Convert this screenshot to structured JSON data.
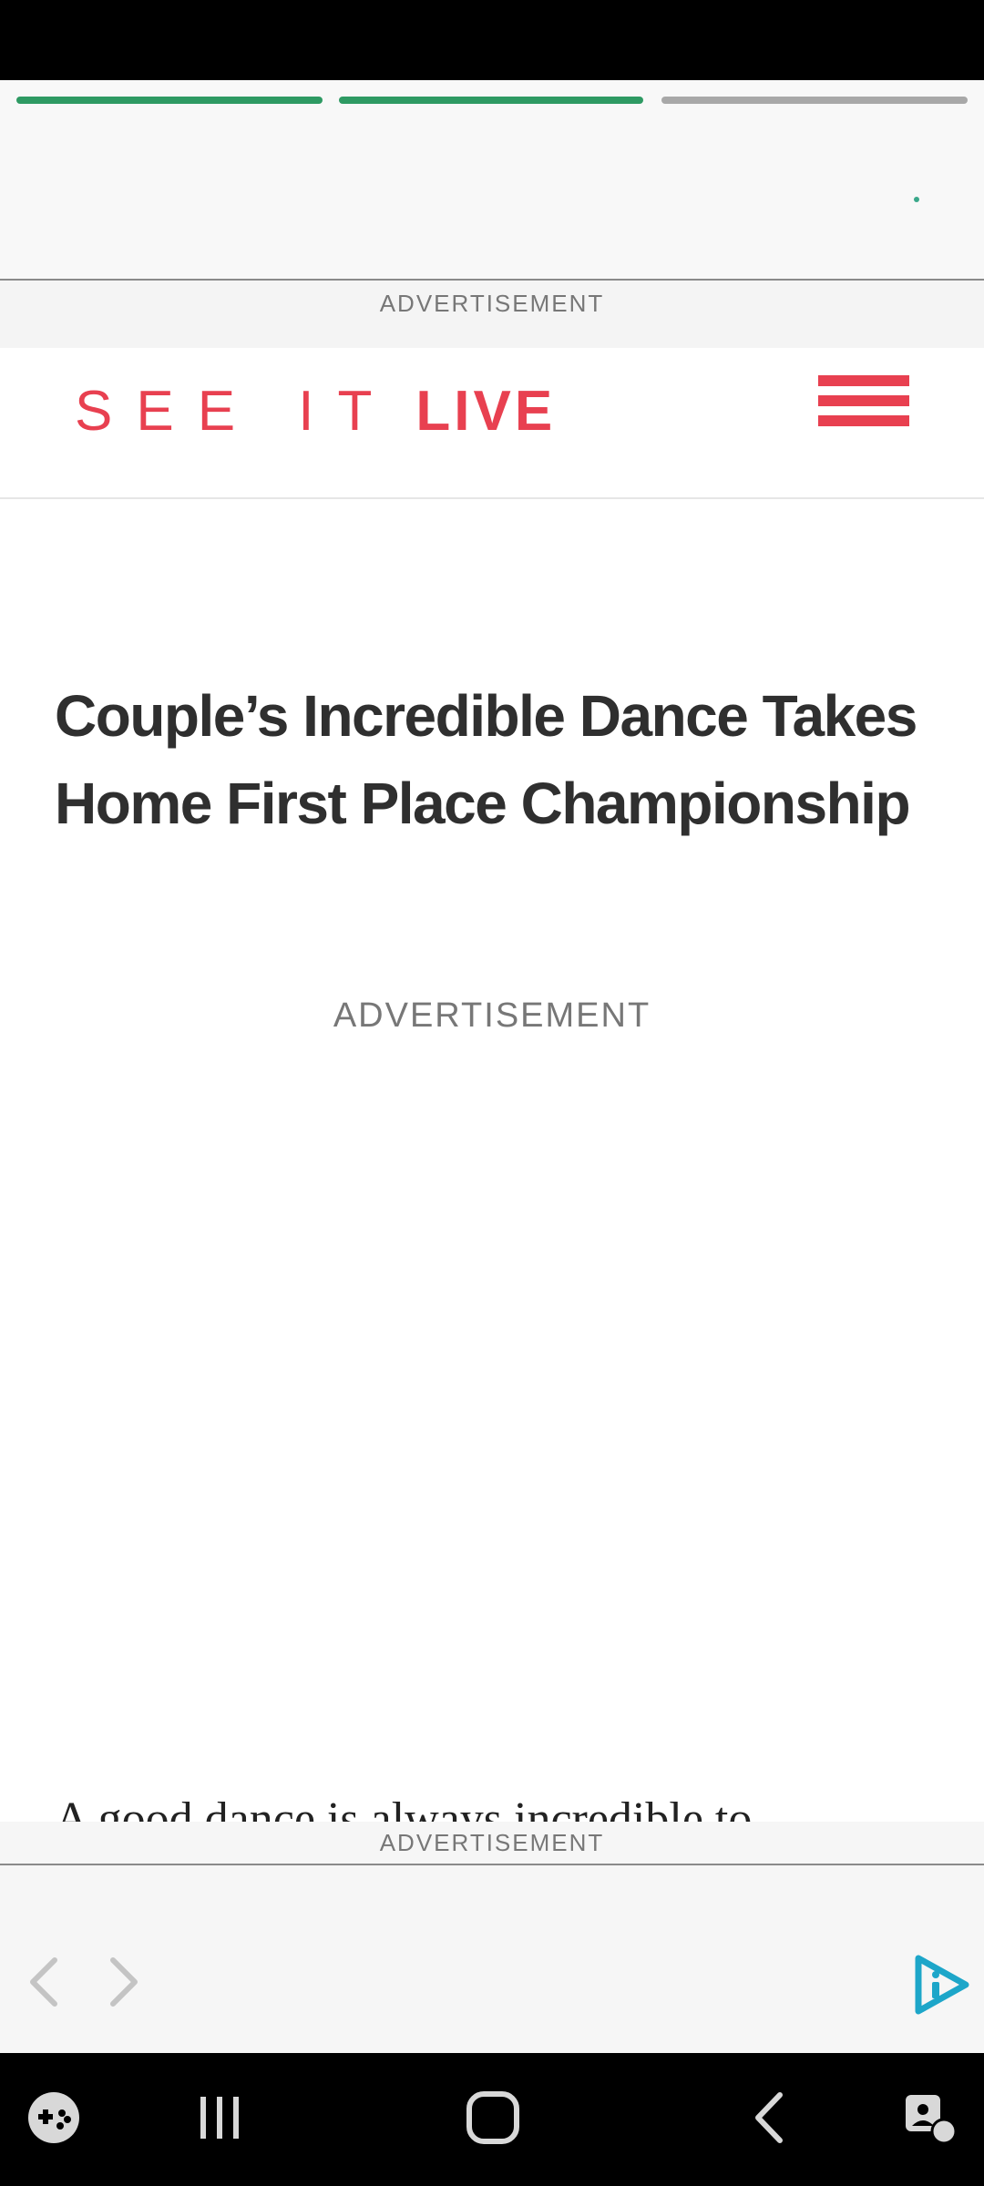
{
  "colors": {
    "brand_red": "#e84050",
    "progress_done": "#2e9a63",
    "progress_pending": "#a8a8a8",
    "ad_logo_blue": "#1da6c9"
  },
  "progress": {
    "segments": [
      {
        "state": "complete"
      },
      {
        "state": "complete"
      },
      {
        "state": "pending"
      }
    ]
  },
  "ads": {
    "top_label": "ADVERTISEMENT",
    "mid_label": "ADVERTISEMENT",
    "bottom_label": "ADVERTISEMENT"
  },
  "header": {
    "logo_part1": "SEE IT",
    "logo_part2": "LIVE",
    "menu_icon": "hamburger-menu-icon"
  },
  "article": {
    "headline": "Couple’s Incredible Dance Takes Home First Place Championship",
    "body_clipped": "A good dance is always incredible to"
  },
  "bottom_ad": {
    "prev_icon": "chevron-left-icon",
    "next_icon": "chevron-right-icon",
    "logo_icon": "ad-info-play-icon"
  },
  "system_nav": {
    "icons": [
      "game-launcher-icon",
      "recent-apps-icon",
      "home-icon",
      "back-icon",
      "accessibility-icon"
    ]
  }
}
